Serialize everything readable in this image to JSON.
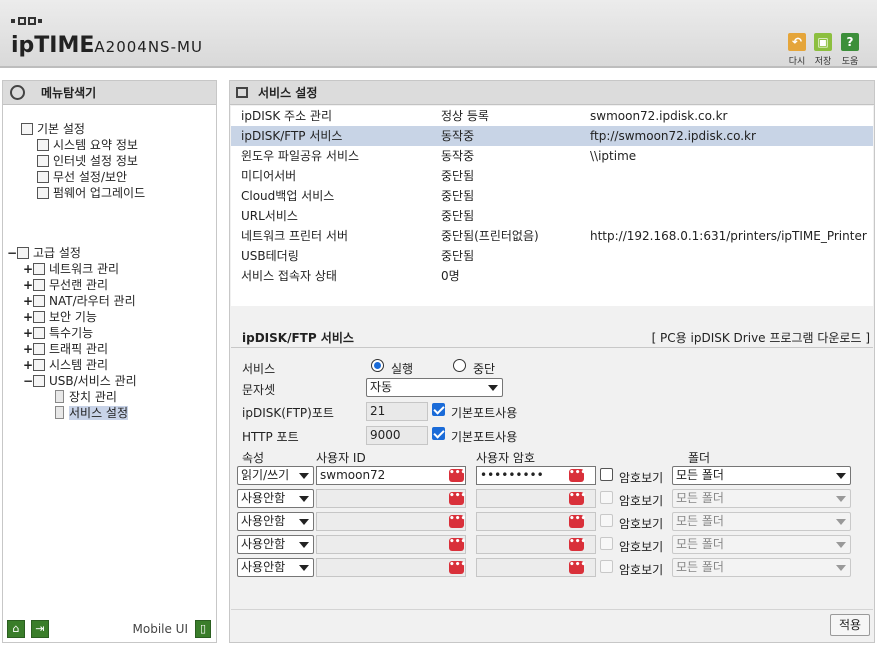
{
  "header": {
    "brand": "ipTIME",
    "model": "A2004NS-MU",
    "buttons": [
      {
        "icon": "undo-icon",
        "label": "다시",
        "color": "#e5a53a"
      },
      {
        "icon": "save-icon",
        "label": "저장",
        "color": "#8cbf3f"
      },
      {
        "icon": "help-icon",
        "label": "도움",
        "color": "#3c8f3a",
        "glyph": "?"
      }
    ]
  },
  "sidebar": {
    "title": "메뉴탐색기",
    "basic": {
      "label": "기본 설정",
      "items": [
        "시스템 요약 정보",
        "인터넷 설정 정보",
        "무선 설정/보안",
        "펌웨어 업그레이드"
      ]
    },
    "advanced": {
      "label": "고급 설정",
      "items": [
        "네트워크 관리",
        "무선랜 관리",
        "NAT/라우터 관리",
        "보안 기능",
        "특수기능",
        "트래픽 관리",
        "시스템 관리",
        "USB/서비스 관리"
      ],
      "usb_children": [
        "장치 관리",
        "서비스 설정"
      ]
    },
    "footer": {
      "mobile_label": "Mobile UI"
    }
  },
  "main": {
    "title": "서비스 설정",
    "status_rows": [
      {
        "name": "ipDISK 주소 관리",
        "status": "정상 등록",
        "info": "swmoon72.ipdisk.co.kr"
      },
      {
        "name": "ipDISK/FTP 서비스",
        "status": "동작중",
        "info": "ftp://swmoon72.ipdisk.co.kr"
      },
      {
        "name": "윈도우 파일공유 서비스",
        "status": "동작중",
        "info": "\\\\iptime"
      },
      {
        "name": "미디어서버",
        "status": "중단됨",
        "info": ""
      },
      {
        "name": "Cloud백업 서비스",
        "status": "중단됨",
        "info": ""
      },
      {
        "name": "URL서비스",
        "status": "중단됨",
        "info": ""
      },
      {
        "name": "네트워크 프린터 서버",
        "status": "중단됨(프린터없음)",
        "info": "http://192.168.0.1:631/printers/ipTIME_Printer"
      },
      {
        "name": "USB테더링",
        "status": "중단됨",
        "info": ""
      },
      {
        "name": "서비스 접속자 상태",
        "status": "0명",
        "info": ""
      }
    ],
    "ftp_section": {
      "title": "ipDISK/FTP 서비스",
      "download_link": "[ PC용 ipDISK Drive 프로그램 다운로드 ]",
      "service_label": "서비스",
      "run_label": "실행",
      "stop_label": "중단",
      "charset_label": "문자셋",
      "charset_value": "자동",
      "ftp_port_label": "ipDISK(FTP)포트",
      "ftp_port_value": "21",
      "http_port_label": "HTTP 포트",
      "http_port_value": "9000",
      "default_port_label": "기본포트사용",
      "col_attr": "속성",
      "col_user": "사용자 ID",
      "col_pass": "사용자 암호",
      "col_folder": "폴더",
      "show_pass_label": "암호보기",
      "accounts": [
        {
          "attr": "읽기/쓰기",
          "user": "swmoon72",
          "password": "•••••••••",
          "folder": "모든 폴더",
          "enabled": true
        },
        {
          "attr": "사용안함",
          "user": "",
          "password": "",
          "folder": "모든 폴더",
          "enabled": false
        },
        {
          "attr": "사용안함",
          "user": "",
          "password": "",
          "folder": "모든 폴더",
          "enabled": false
        },
        {
          "attr": "사용안함",
          "user": "",
          "password": "",
          "folder": "모든 폴더",
          "enabled": false
        },
        {
          "attr": "사용안함",
          "user": "",
          "password": "",
          "folder": "모든 폴더",
          "enabled": false
        }
      ],
      "apply_label": "적용"
    }
  }
}
